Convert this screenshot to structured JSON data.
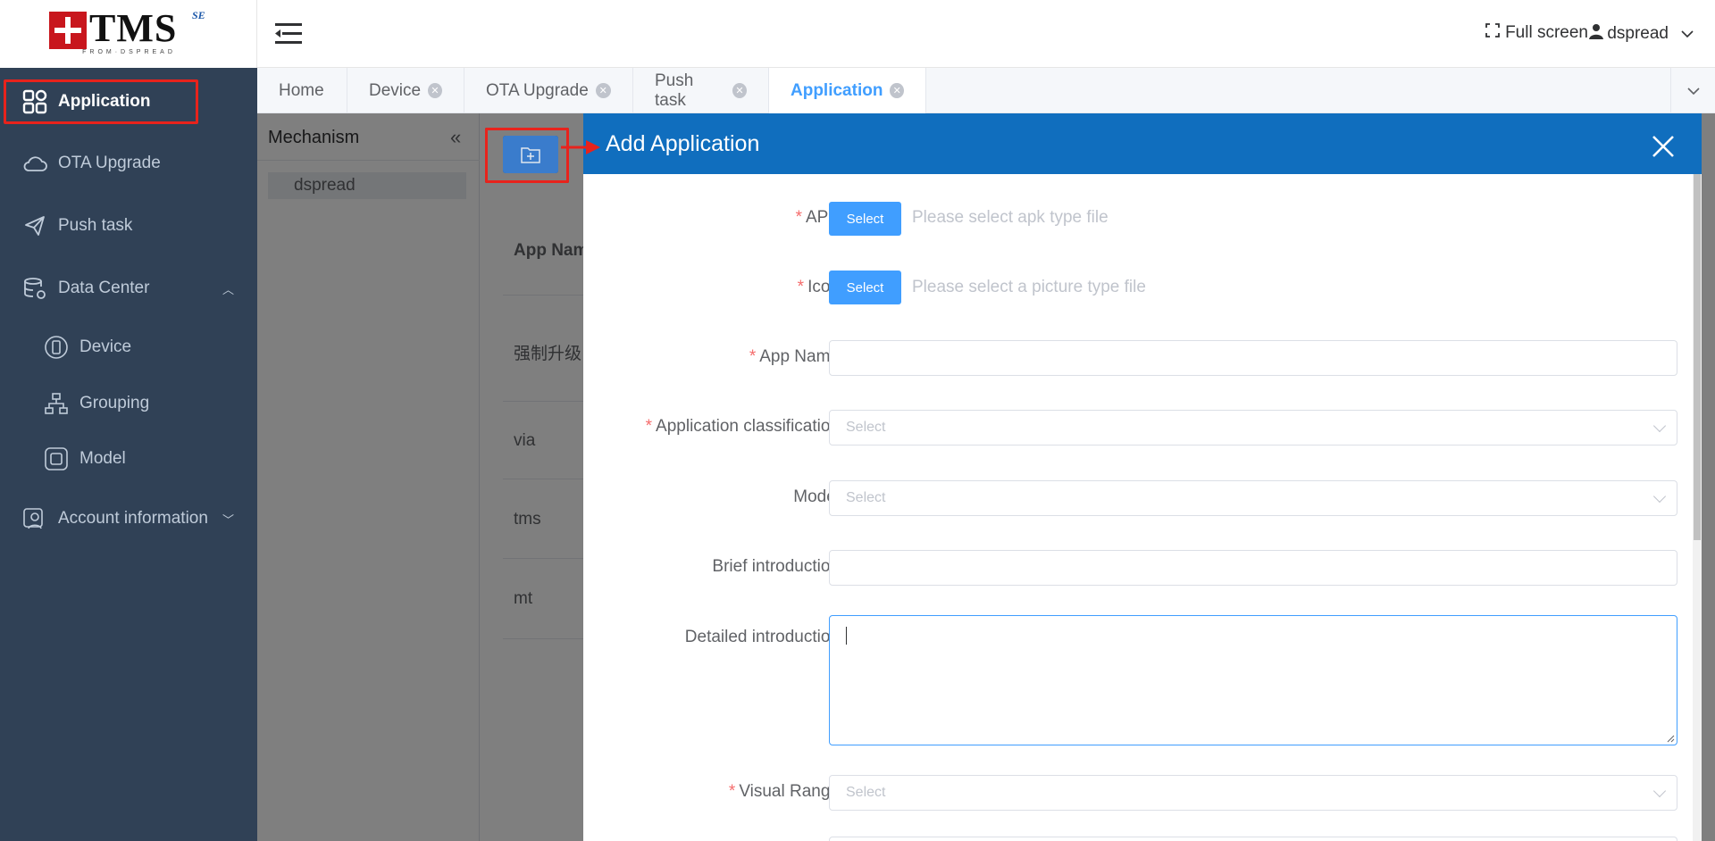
{
  "logo": {
    "text": "TMS",
    "suffix": "SE",
    "sub": "FROM·DSPREAD"
  },
  "sidebar": {
    "items": [
      {
        "label": "Application"
      },
      {
        "label": "OTA Upgrade"
      },
      {
        "label": "Push task"
      },
      {
        "label": "Data Center"
      },
      {
        "label": "Device"
      },
      {
        "label": "Grouping"
      },
      {
        "label": "Model"
      },
      {
        "label": "Account information"
      }
    ]
  },
  "header": {
    "fullscreen": "Full screen",
    "user": "dspread"
  },
  "tabs": [
    {
      "label": "Home"
    },
    {
      "label": "Device"
    },
    {
      "label": "OTA Upgrade"
    },
    {
      "label": "Push task"
    },
    {
      "label": "Application"
    }
  ],
  "mechanism": {
    "title": "Mechanism",
    "node": "dspread"
  },
  "table": {
    "header": "App Nam",
    "rows": [
      "强制升级",
      "via",
      "tms",
      "mt"
    ]
  },
  "dialog": {
    "title": "Add Application",
    "select_button": "Select",
    "fields": {
      "apk_label": "APK",
      "apk_hint": "Please select apk type file",
      "icon_label": "Icon",
      "icon_hint": "Please select a picture type file",
      "app_name_label": "App Name",
      "classification_label": "Application classification",
      "classification_placeholder": "Select",
      "model_label": "Model",
      "model_placeholder": "Select",
      "brief_label": "Brief introduction",
      "detailed_label": "Detailed introduction",
      "visual_label": "Visual Range",
      "visual_placeholder": "Select"
    }
  },
  "colors": {
    "sidebar_bg": "#304156",
    "dialog_header": "#106ebe",
    "primary": "#409eff",
    "highlight": "#e8231c"
  }
}
